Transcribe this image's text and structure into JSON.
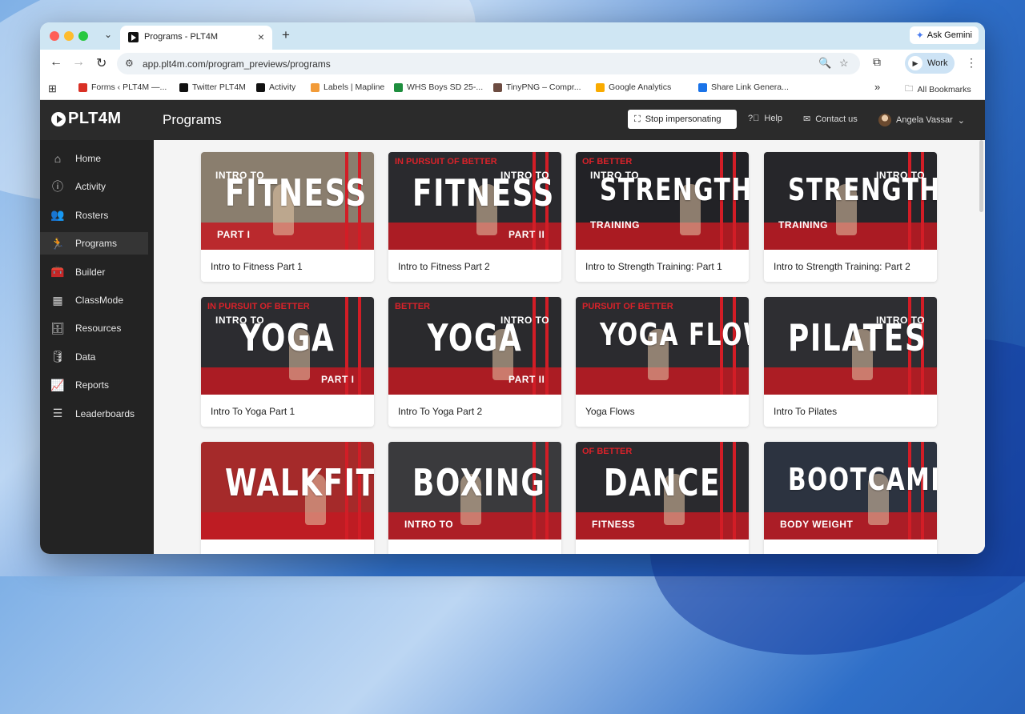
{
  "browser": {
    "tab_title": "Programs - PLT4M",
    "tab_close": "×",
    "new_tab": "+",
    "ask_gemini": "Ask Gemini",
    "url": "app.plt4m.com/program_previews/programs",
    "profile_label": "Work",
    "bookmarks": [
      {
        "label": "Forms ‹ PLT4M —...",
        "color": "#d93025"
      },
      {
        "label": "Twitter PLT4M",
        "color": "#111111"
      },
      {
        "label": "Activity",
        "color": "#111111"
      },
      {
        "label": "Labels | Mapline",
        "color": "#f29b38"
      },
      {
        "label": "WHS Boys SD 25-...",
        "color": "#1e8e3e"
      },
      {
        "label": "TinyPNG – Compr...",
        "color": "#6d4c41"
      },
      {
        "label": "Google Analytics",
        "color": "#f9ab00"
      },
      {
        "label": "Share Link Genera...",
        "color": "#1a73e8"
      }
    ],
    "bookmarks_overflow": "»",
    "all_bookmarks": "All Bookmarks"
  },
  "app": {
    "logo_text": "PLT4M",
    "page_title": "Programs",
    "stop_impersonating": "Stop impersonating",
    "help": "Help",
    "contact": "Contact us",
    "user_name": "Angela Vassar"
  },
  "sidebar": {
    "items": [
      {
        "label": "Home",
        "icon": "home-icon",
        "glyph": "⌂"
      },
      {
        "label": "Activity",
        "icon": "info-icon",
        "glyph": "ⓘ"
      },
      {
        "label": "Rosters",
        "icon": "people-icon",
        "glyph": "👥"
      },
      {
        "label": "Programs",
        "icon": "runner-icon",
        "glyph": "🏃",
        "active": true
      },
      {
        "label": "Builder",
        "icon": "toolbox-icon",
        "glyph": "🧰"
      },
      {
        "label": "ClassMode",
        "icon": "classroom-icon",
        "glyph": "▦"
      },
      {
        "label": "Resources",
        "icon": "cabinet-icon",
        "glyph": "🗄"
      },
      {
        "label": "Data",
        "icon": "database-icon",
        "glyph": "🛢"
      },
      {
        "label": "Reports",
        "icon": "chart-icon",
        "glyph": "📈"
      },
      {
        "label": "Leaderboards",
        "icon": "list-icon",
        "glyph": "☰"
      }
    ]
  },
  "programs": [
    {
      "label": "Intro to Fitness Part 1",
      "thumb_title": "FITNESS",
      "thumb_top": "INTRO TO",
      "thumb_sub": "PART I",
      "pursuit": "",
      "bg": "#8a7e6e"
    },
    {
      "label": "Intro to Fitness Part 2",
      "thumb_title": "FITNESS",
      "thumb_top": "INTRO TO",
      "thumb_sub": "PART II",
      "pursuit": "IN PURSUIT OF BETTER",
      "bg": "#2a2a2e"
    },
    {
      "label": "Intro to Strength Training: Part 1",
      "thumb_title": "STRENGTH",
      "thumb_top": "INTRO TO",
      "thumb_sub": "TRAINING",
      "pursuit": "OF BETTER",
      "bg": "#222226"
    },
    {
      "label": "Intro to Strength Training: Part 2",
      "thumb_title": "STRENGTH",
      "thumb_top": "INTRO TO",
      "thumb_sub": "TRAINING",
      "pursuit": "",
      "bg": "#26262a"
    },
    {
      "label": "Intro To Yoga Part 1",
      "thumb_title": "YOGA",
      "thumb_top": "INTRO TO",
      "thumb_sub": "PART I",
      "pursuit": "IN PURSUIT OF BETTER",
      "bg": "#2c2c30"
    },
    {
      "label": "Intro To Yoga Part 2",
      "thumb_title": "YOGA",
      "thumb_top": "INTRO TO",
      "thumb_sub": "PART II",
      "pursuit": "BETTER",
      "bg": "#2a2a2d"
    },
    {
      "label": "Yoga Flows",
      "thumb_title": "YOGA FLOWS",
      "thumb_top": "",
      "thumb_sub": "",
      "pursuit": "PURSUIT OF BETTER",
      "bg": "#2b2b2f"
    },
    {
      "label": "Intro To Pilates",
      "thumb_title": "PILATES",
      "thumb_top": "INTRO TO",
      "thumb_sub": "",
      "pursuit": "",
      "bg": "#2e2e32"
    },
    {
      "label": "",
      "thumb_title": "WALKFIT",
      "thumb_top": "",
      "thumb_sub": "",
      "pursuit": "",
      "bg": "#a52a2a"
    },
    {
      "label": "",
      "thumb_title": "BOXING",
      "thumb_top": "",
      "thumb_sub": "INTRO TO",
      "pursuit": "",
      "bg": "#3a3a3d"
    },
    {
      "label": "",
      "thumb_title": "DANCE",
      "thumb_top": "",
      "thumb_sub": "FITNESS",
      "pursuit": "OF BETTER",
      "bg": "#2a2a2e"
    },
    {
      "label": "",
      "thumb_title": "BOOTCAMP",
      "thumb_top": "",
      "thumb_sub": "BODY WEIGHT",
      "pursuit": "",
      "bg": "#2c3340"
    }
  ]
}
